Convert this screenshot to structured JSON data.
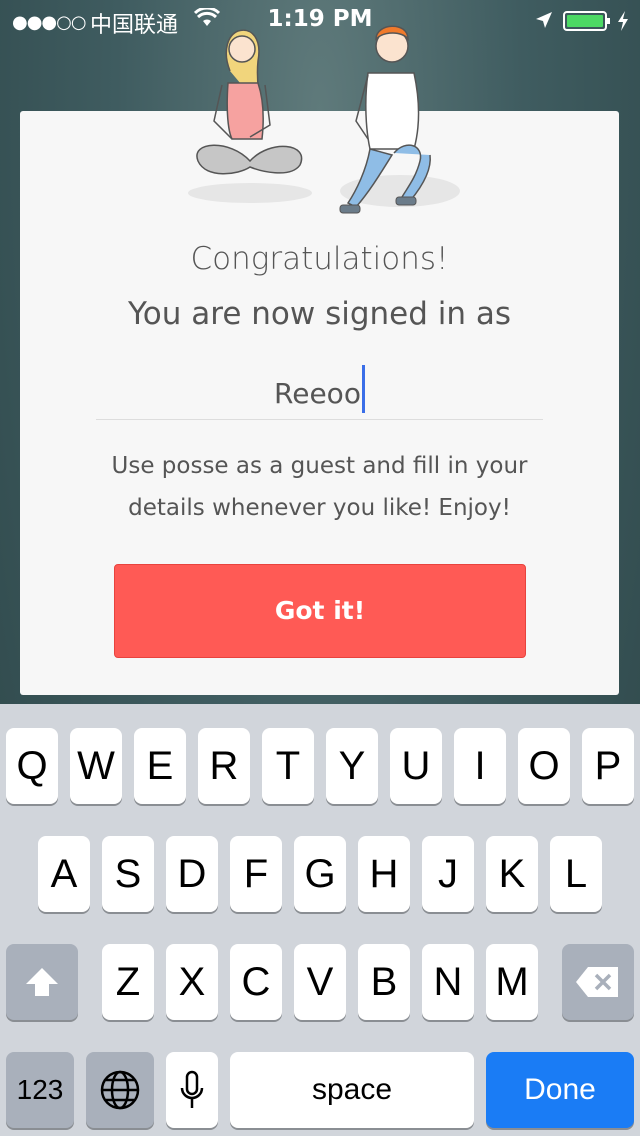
{
  "status": {
    "signal": "●●●○○",
    "carrier": "中国联通",
    "time": "1:19 PM"
  },
  "dialog": {
    "title": "Congratulations!",
    "subtitle": "You are now signed in as",
    "username": "Reeoo",
    "message": "Use posse as a guest and fill in your details whenever you like! Enjoy!",
    "button_label": "Got it!"
  },
  "keyboard": {
    "row1": [
      "Q",
      "W",
      "E",
      "R",
      "T",
      "Y",
      "U",
      "I",
      "O",
      "P"
    ],
    "row2": [
      "A",
      "S",
      "D",
      "F",
      "G",
      "H",
      "J",
      "K",
      "L"
    ],
    "row3": [
      "Z",
      "X",
      "C",
      "V",
      "B",
      "N",
      "M"
    ],
    "numbers_label": "123",
    "space_label": "space",
    "done_label": "Done"
  },
  "colors": {
    "accent": "#ff5a55",
    "done_key": "#1a7cf5",
    "caret": "#3a6ee8"
  }
}
